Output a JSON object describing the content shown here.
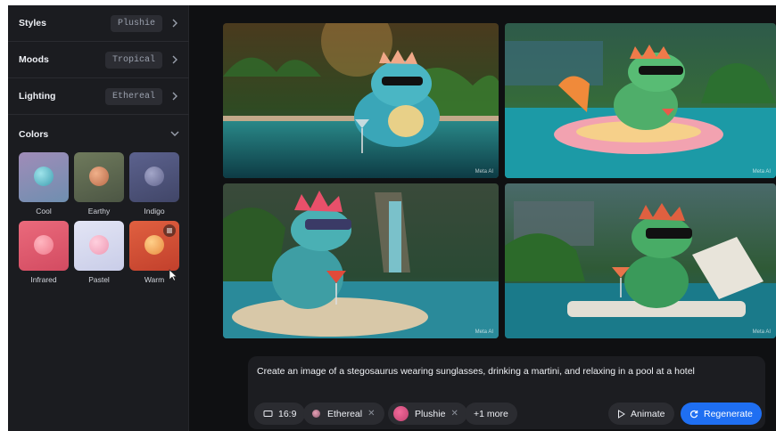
{
  "sidebar": {
    "rows": [
      {
        "label": "Styles",
        "value": "Plushie"
      },
      {
        "label": "Moods",
        "value": "Tropical"
      },
      {
        "label": "Lighting",
        "value": "Ethereal"
      }
    ],
    "colors_label": "Colors",
    "swatches": [
      {
        "label": "Cool",
        "bg": "#8f9bb4",
        "ball": "#5fb7c7"
      },
      {
        "label": "Earthy",
        "bg": "#5f6a52",
        "ball": "#cf8a62"
      },
      {
        "label": "Indigo",
        "bg": "#545a82",
        "ball": "#7c7fa6"
      },
      {
        "label": "Infrared",
        "bg": "#e35f72",
        "ball": "#f48a9a"
      },
      {
        "label": "Pastel",
        "bg": "#d8dbef",
        "ball": "#f1a7bd"
      },
      {
        "label": "Warm",
        "bg": "#d9533a",
        "ball": "#f0a050"
      }
    ]
  },
  "gallery": {
    "watermark": "Meta AI"
  },
  "prompt": {
    "text": "Create an image of a stegosaurus wearing sunglasses, drinking a martini, and relaxing in a pool at a hotel",
    "aspect": "16:9",
    "lighting_tag": "Ethereal",
    "style_tag": "Plushie",
    "more": "+1 more",
    "animate": "Animate",
    "regenerate": "Regenerate"
  },
  "colors": {
    "accent": "#1f6ff2",
    "sidebar_bg": "#1b1c20",
    "app_bg": "#0f1012"
  }
}
